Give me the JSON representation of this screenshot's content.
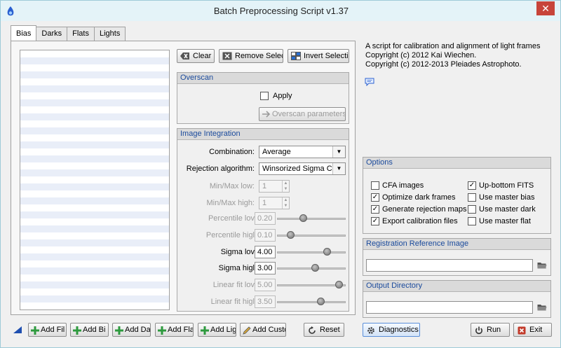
{
  "window": {
    "title": "Batch Preprocessing Script v1.37"
  },
  "tabs": [
    {
      "label": "Bias"
    },
    {
      "label": "Darks"
    },
    {
      "label": "Flats"
    },
    {
      "label": "Lights"
    }
  ],
  "file_buttons": {
    "clear": "Clear",
    "remove_selected": "Remove Selecte",
    "invert_selection": "Invert Selectio"
  },
  "overscan": {
    "title": "Overscan",
    "apply_label": "Apply",
    "apply_checked": false,
    "params_button": "Overscan parameters."
  },
  "integration": {
    "title": "Image Integration",
    "combination_label": "Combination:",
    "combination_value": "Average",
    "rejection_label": "Rejection algorithm:",
    "rejection_value": "Winsorized Sigma C",
    "minmax_low_label": "Min/Max low:",
    "minmax_low_value": "1",
    "minmax_high_label": "Min/Max high:",
    "minmax_high_value": "1",
    "percentile_low_label": "Percentile lov",
    "percentile_low_value": "0.20",
    "percentile_high_label": "Percentile higl",
    "percentile_high_value": "0.10",
    "sigma_low_label": "Sigma lov",
    "sigma_low_value": "4.00",
    "sigma_high_label": "Sigma higl",
    "sigma_high_value": "3.00",
    "linear_low_label": "Linear fit lov",
    "linear_low_value": "5.00",
    "linear_high_label": "Linear fit higl",
    "linear_high_value": "3.50"
  },
  "info": {
    "line1": "A script for calibration and alignment of light frames",
    "line2": "Copyright (c) 2012 Kai Wiechen.",
    "line3": "Copyright (c) 2012-2013 Pleiades Astrophoto."
  },
  "options": {
    "title": "Options",
    "items": [
      {
        "label": "CFA images",
        "checked": false
      },
      {
        "label": "Optimize dark frames",
        "checked": true
      },
      {
        "label": "Generate rejection maps",
        "checked": true
      },
      {
        "label": "Export calibration files",
        "checked": true
      },
      {
        "label": "Up-bottom FITS",
        "checked": true
      },
      {
        "label": "Use master bias",
        "checked": false
      },
      {
        "label": "Use master dark",
        "checked": false
      },
      {
        "label": "Use master flat",
        "checked": false
      }
    ]
  },
  "registration": {
    "title": "Registration Reference Image",
    "value": ""
  },
  "output": {
    "title": "Output Directory",
    "value": ""
  },
  "bottom_buttons": {
    "add_files": "Add Fil",
    "add_bias": "Add Bi",
    "add_darks": "Add Da",
    "add_flats": "Add Fla",
    "add_lights": "Add Ligl",
    "add_custom": "Add Custo",
    "reset": "Reset",
    "diagnostics": "Diagnostics",
    "run": "Run",
    "exit": "Exit"
  },
  "colors": {
    "group_title": "#1a4a9c",
    "close": "#c7443a",
    "add_icon": "#2e9a3e",
    "exit_icon": "#c23a2a"
  }
}
